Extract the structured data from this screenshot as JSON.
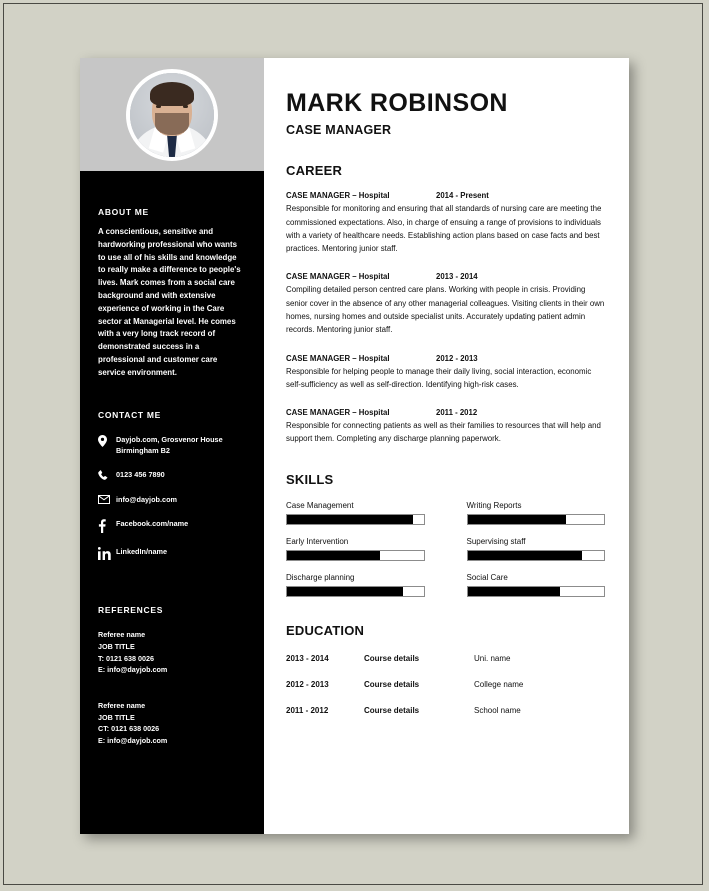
{
  "theme": {
    "page_background": "#d2d2c6",
    "sidebar_background": "#000000",
    "photo_panel_background": "#c6c6c6",
    "paper_background": "#ffffff",
    "text_dark": "#111111",
    "text_light": "#ffffff"
  },
  "header": {
    "name": "MARK ROBINSON",
    "role": "CASE MANAGER"
  },
  "sidebar": {
    "about": {
      "heading": "ABOUT ME",
      "text": "A conscientious, sensitive and hardworking professional who wants to use all of his skills and knowledge to really make a difference to people's lives. Mark comes from a social care background and with extensive experience of working in the Care sector at Managerial level. He comes with a very long track record of demonstrated success in a professional and customer care service environment."
    },
    "contact": {
      "heading": "CONTACT ME",
      "items": [
        {
          "icon": "location-pin-icon",
          "text": "Dayjob.com, Grosvenor House Birmingham B2"
        },
        {
          "icon": "phone-icon",
          "text": "0123 456 7890"
        },
        {
          "icon": "envelope-icon",
          "text": "info@dayjob.com"
        },
        {
          "icon": "facebook-icon",
          "text": "Facebook.com/name"
        },
        {
          "icon": "linkedin-icon",
          "text": "LinkedIn/name"
        }
      ]
    },
    "references": {
      "heading": "REFERENCES",
      "items": [
        {
          "name": "Referee name",
          "title": "JOB TITLE",
          "phone": "T: 0121 638 0026",
          "email": "E: info@dayjob.com"
        },
        {
          "name": "Referee name",
          "title": "JOB TITLE",
          "phone": "CT: 0121 638 0026",
          "email": "E: info@dayjob.com"
        }
      ]
    }
  },
  "career": {
    "heading": "CAREER",
    "jobs": [
      {
        "title": "CASE MANAGER –   Hospital",
        "dates": "2014 - Present",
        "description": "Responsible for monitoring and ensuring that all standards of nursing care are meeting the commissioned expectations. Also, in charge of ensuing a range of provisions to individuals with a variety of healthcare needs. Establishing action plans based on case facts and best practices. Mentoring junior staff."
      },
      {
        "title": "CASE MANAGER –   Hospital",
        "dates": "2013 - 2014",
        "description": "Compiling detailed person centred care plans. Working with people in crisis. Providing senior cover in the absence of any other managerial colleagues. Visiting clients in their own homes, nursing homes and outside specialist units. Accurately updating patient admin records. Mentoring junior staff."
      },
      {
        "title": "CASE MANAGER –   Hospital",
        "dates": "2012 - 2013",
        "description": "Responsible for helping people to manage their daily living, social interaction, economic self-sufficiency as well as self-direction. Identifying high-risk cases."
      },
      {
        "title": "CASE MANAGER –   Hospital",
        "dates": "2011 - 2012",
        "description": "Responsible for connecting patients as well as their families to resources that will help and support them. Completing any discharge planning paperwork."
      }
    ]
  },
  "skills": {
    "heading": "SKILLS",
    "items": [
      {
        "label": "Case Management",
        "level": 92
      },
      {
        "label": "Writing Reports",
        "level": 72
      },
      {
        "label": "Early Intervention",
        "level": 68
      },
      {
        "label": "Supervising staff",
        "level": 84
      },
      {
        "label": "Discharge planning",
        "level": 85
      },
      {
        "label": "Social Care",
        "level": 68
      }
    ]
  },
  "education": {
    "heading": "EDUCATION",
    "rows": [
      {
        "years": "2013 - 2014",
        "course": "Course details",
        "place": "Uni. name"
      },
      {
        "years": "2012 - 2013",
        "course": "Course details",
        "place": "College name"
      },
      {
        "years": "2011 - 2012",
        "course": "Course details",
        "place": "School name"
      }
    ]
  }
}
